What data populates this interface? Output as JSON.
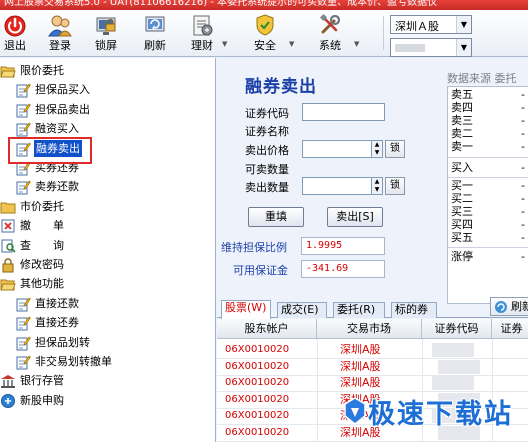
{
  "title": "网上股票交易系统5.0 - UAT(81106616216) - 本委托系统提示的可买数量、成本价、盈亏数据仅",
  "toolbar": {
    "exit": "退出",
    "login": "登录",
    "lock": "锁屏",
    "refresh": "刷新",
    "finance": "理财",
    "security": "安全",
    "system": "系统",
    "market": "深圳Ａ股"
  },
  "tree": [
    {
      "label": "限价委托",
      "icon": "folder-open-icon",
      "level": 0
    },
    {
      "label": "担保品买入",
      "icon": "order-pencil-icon",
      "level": 1
    },
    {
      "label": "担保品卖出",
      "icon": "order-pencil-icon",
      "level": 1
    },
    {
      "label": "融资买入",
      "icon": "order-pencil-icon",
      "level": 1
    },
    {
      "label": "融券卖出",
      "icon": "order-pencil-icon",
      "level": 1,
      "selected": true
    },
    {
      "label": "买券还券",
      "icon": "order-pencil-icon",
      "level": 1
    },
    {
      "label": "卖券还款",
      "icon": "order-pencil-icon",
      "level": 1
    },
    {
      "label": "市价委托",
      "icon": "folder-closed-icon",
      "level": 0
    },
    {
      "label": "撤　　单",
      "icon": "cancel-order-icon",
      "level": 0
    },
    {
      "label": "查　　询",
      "icon": "query-icon",
      "level": 0
    },
    {
      "label": "修改密码",
      "icon": "password-icon",
      "level": 0
    },
    {
      "label": "其他功能",
      "icon": "folder-open-icon",
      "level": 0
    },
    {
      "label": "直接还款",
      "icon": "order-pencil-icon",
      "level": 1
    },
    {
      "label": "直接还券",
      "icon": "order-pencil-icon",
      "level": 1
    },
    {
      "label": "担保品划转",
      "icon": "order-pencil-icon",
      "level": 1
    },
    {
      "label": "非交易划转撤单",
      "icon": "order-pencil-icon",
      "level": 1
    },
    {
      "label": "银行存管",
      "icon": "bank-icon",
      "level": 0
    },
    {
      "label": "新股申购",
      "icon": "ipo-icon",
      "level": 0
    }
  ],
  "form": {
    "title": "融券卖出",
    "code_label": "证券代码",
    "name_label": "证券名称",
    "price_label": "卖出价格",
    "available_label": "可卖数量",
    "qty_label": "卖出数量",
    "lock_label": "锁",
    "reset_label": "重填",
    "sell_label": "卖出[S]",
    "ratio_label": "维持担保比例",
    "ratio_value": "1.9995",
    "margin_label": "可用保证金",
    "margin_value": "-341.69"
  },
  "quote": {
    "header": "数据来源  委托",
    "dash": "-",
    "sell_rows": [
      "卖五",
      "卖四",
      "卖三",
      "卖二",
      "卖一"
    ],
    "buy_label": "买入",
    "buy_rows": [
      "买一",
      "买二",
      "买三",
      "买四",
      "买五"
    ],
    "limit_label": "涨停"
  },
  "tabs": [
    "股票(W)",
    "成交(E)",
    "委托(R)",
    "标的券"
  ],
  "refresh_label": "刷新",
  "table": {
    "columns": [
      "股东帐户",
      "交易市场",
      "证券代码",
      "证券"
    ],
    "rows": [
      {
        "account": "06X0010020",
        "market": "深圳A股"
      },
      {
        "account": "06X0010020",
        "market": "深圳A股"
      },
      {
        "account": "06X0010020",
        "market": "深圳A股"
      },
      {
        "account": "06X0010020",
        "market": "深圳A股"
      },
      {
        "account": "06X0010020",
        "market": "深圳A股"
      },
      {
        "account": "06X0010020",
        "market": "深圳A股"
      }
    ]
  },
  "watermark": "极速下载站",
  "colors": {
    "accent": "#1c3fa8",
    "selected": "#1050c8",
    "value_red": "#d40000",
    "highlight_box": "#e12b2b"
  }
}
